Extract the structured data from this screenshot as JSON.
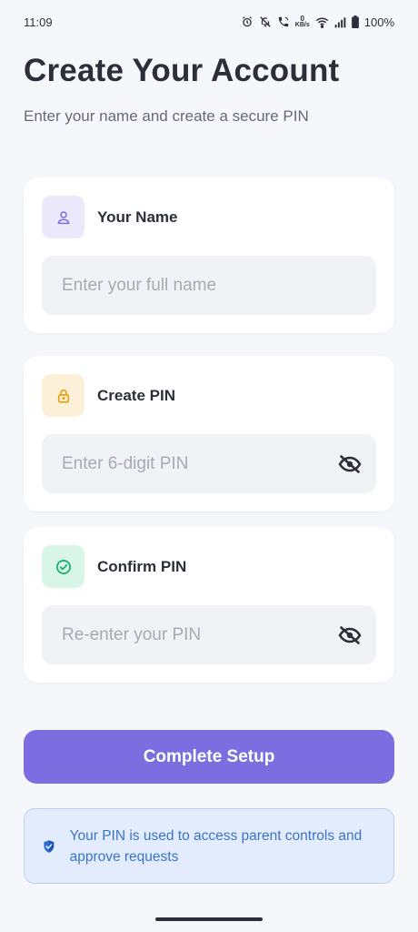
{
  "status_bar": {
    "time": "11:09",
    "network_rate_unit": "KB/s",
    "battery": "100%",
    "icons": [
      "alarm-icon",
      "bell-off-icon",
      "wifi-call-icon",
      "kbs-icon",
      "wifi-icon",
      "signal-icon",
      "battery-icon"
    ]
  },
  "header": {
    "title": "Create Your Account",
    "subtitle": "Enter your name and create a secure PIN"
  },
  "name_card": {
    "label": "Your Name",
    "icon": "person-icon",
    "placeholder": "Enter your full name",
    "value": ""
  },
  "pin_card": {
    "label": "Create PIN",
    "icon": "lock-icon",
    "placeholder": "Enter 6-digit PIN",
    "value": "",
    "toggle_icon": "eye-off-icon"
  },
  "confirm_card": {
    "label": "Confirm PIN",
    "icon": "check-circle-icon",
    "placeholder": "Re-enter your PIN",
    "value": "",
    "toggle_icon": "eye-off-icon"
  },
  "primary_button": {
    "label": "Complete Setup"
  },
  "info": {
    "icon": "shield-icon",
    "text": "Your PIN is used to access parent controls and approve requests"
  },
  "colors": {
    "background": "#f5f7fb",
    "accent": "#7c6ee0",
    "name_icon_bg": "#ebe8fb",
    "name_icon": "#7c6ee0",
    "pin_icon_bg": "#fdf0d9",
    "pin_icon": "#e8a312",
    "confirm_icon_bg": "#d9f5e8",
    "confirm_icon": "#1bb071",
    "info_bg": "#e3ecfc",
    "info_text": "#3a74c9"
  }
}
